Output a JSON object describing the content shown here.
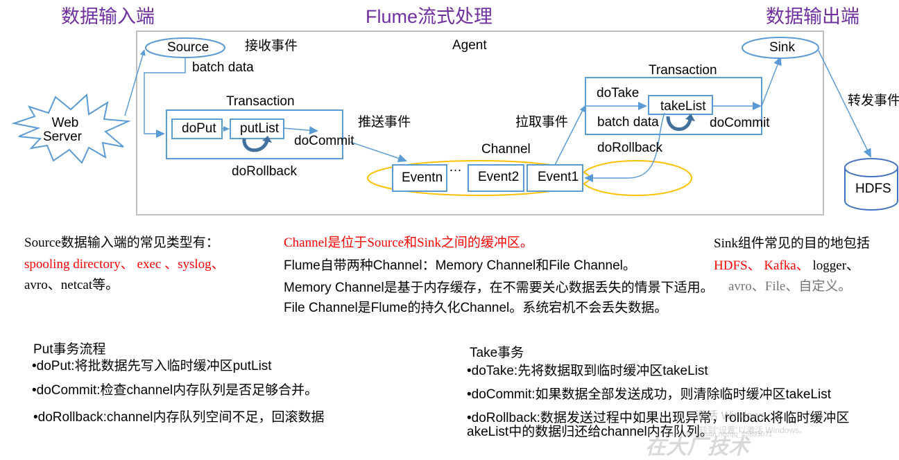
{
  "headings": {
    "input": "数据输入端",
    "process": "Flume流式处理",
    "output": "数据输出端"
  },
  "diagram": {
    "agent_label": "Agent",
    "web_server": [
      "Web",
      "Server"
    ],
    "source": "Source",
    "receive_event": "接收事件",
    "batch_data_source": "batch data",
    "put_transaction": {
      "title": "Transaction",
      "do_put": "doPut",
      "put_list": "putList",
      "do_commit": "doCommit",
      "do_rollback": "doRollback"
    },
    "push_event": "推送事件",
    "pull_event": "拉取事件",
    "channel": {
      "title": "Channel",
      "events": [
        "Eventn",
        "Event2",
        "Event1"
      ],
      "ellipsis": "…"
    },
    "take_transaction": {
      "title": "Transaction",
      "do_take": "doTake",
      "take_list": "takeList",
      "batch_data": "batch data",
      "do_commit": "doCommit",
      "do_rollback": "doRollback"
    },
    "sink": "Sink",
    "forward_event": "转发事件",
    "hdfs": "HDFS",
    "colors": {
      "heading": "#7030a0",
      "diagram_line": "#5b9bd5",
      "channel_ellipse": "#ffc000",
      "agent_border": "#bfbfbf",
      "highlight": "#ff0000"
    }
  },
  "notes": {
    "source": {
      "line1": "Source数据输入端的常见类型有：",
      "line2_red": "spooling directory、 exec 、syslog、",
      "line3": "avro、netcat等。"
    },
    "channel": {
      "line1_red": "Channel是位于Source和Sink之间的缓冲区。",
      "line2": "Flume自带两种Channel：Memory Channel和File Channel。",
      "line3": "Memory Channel是基于内存缓存，在不需要关心数据丢失的情景下适用。",
      "line4": "File Channel是Flume的持久化Channel。系统宕机不会丢失数据。"
    },
    "sink": {
      "line1": "Sink组件常见的目的地包括",
      "line2_red_a": "HDFS、",
      "line2_red_b": "Kafka、",
      "line2_black": "logger、",
      "line3": "avro、File、自定义。"
    }
  },
  "put_flow": {
    "title": "Put事务流程",
    "items": [
      "•doPut:将批数据先写入临时缓冲区putList",
      "•doCommit:检查channel内存队列是否足够合并。",
      "•doRollback:channel内存队列空间不足，回滚数据"
    ]
  },
  "take_flow": {
    "title": "Take事务",
    "items": [
      "•doTake:先将数据取到临时缓冲区takeList",
      "•doCommit:如果数据全部发送成功，则清除临时缓冲区takeList",
      "•doRollback:数据发送过程中如果出现异常，rollback将临时缓冲区",
      "akeList中的数据归还给channel内存队列。"
    ]
  },
  "overlay": {
    "activate_windows": "激活 Windows",
    "activate_hint": "转到“设置”以激活 Windows。",
    "url_watermark": "https://blog.csdn.net/qq_45893071",
    "faded_text": "在大厂技术"
  }
}
